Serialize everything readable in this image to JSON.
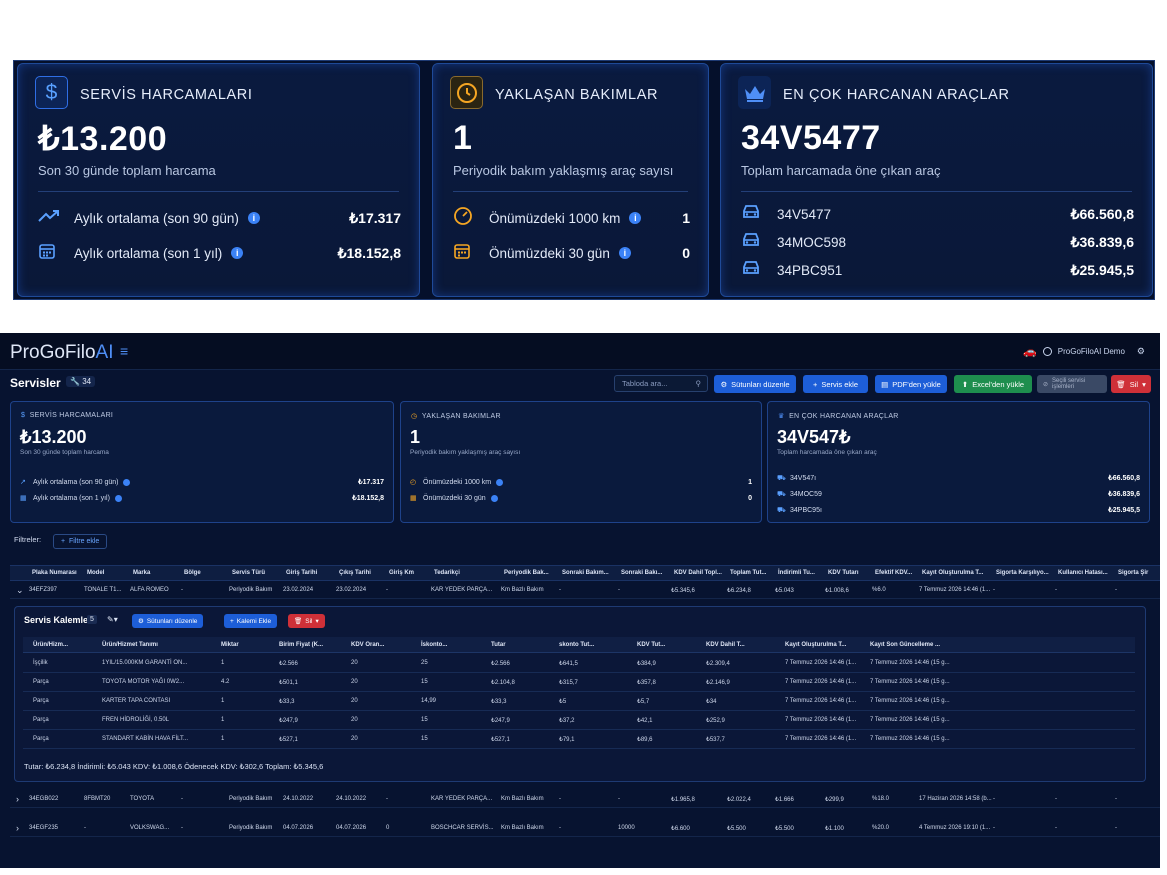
{
  "zoom": {
    "service": {
      "icon": "dollar-icon",
      "title": "SERVİS HARCAMALARI",
      "big": "₺13.200",
      "sub": "Son 30 günde toplam harcama",
      "rows": [
        {
          "icon": "trend-up-icon",
          "label": "Aylık ortalama (son 90 gün)",
          "value": "₺17.317"
        },
        {
          "icon": "calendar-icon",
          "label": "Aylık ortalama (son 1 yıl)",
          "value": "₺18.152,8"
        }
      ]
    },
    "maintenance": {
      "icon": "clock-icon",
      "title": "YAKLAŞAN BAKIMLAR",
      "big": "1",
      "sub": "Periyodik bakım yaklaşmış araç sayısı",
      "rows": [
        {
          "icon": "gauge-icon",
          "label": "Önümüzdeki 1000 km",
          "value": "1"
        },
        {
          "icon": "calendar-icon",
          "label": "Önümüzdeki 30 gün",
          "value": "0"
        }
      ]
    },
    "top": {
      "icon": "crown-icon",
      "title": "EN ÇOK HARCANAN ARAÇLAR",
      "big": "34V5477",
      "sub": "Toplam harcamada öne çıkan araç",
      "rows": [
        {
          "icon": "car-icon",
          "label": "34V5477",
          "value": "₺66.560,8"
        },
        {
          "icon": "car-icon",
          "label": "34MOC598",
          "value": "₺36.839,6"
        },
        {
          "icon": "car-icon",
          "label": "34PBC951",
          "value": "₺25.945,5"
        }
      ]
    }
  },
  "app": {
    "logo_main": "ProGoFilo",
    "logo_ai": "AI",
    "user": "ProGoFiloAI Demo",
    "page_title": "Servisler",
    "count": "34",
    "search_placeholder": "Tabloda ara...",
    "buttons": {
      "columns": "Sütunları düzenle",
      "add": "Servis ekle",
      "pdf": "PDF'den yükle",
      "excel": "Excel'den yükle",
      "selected": "Seçili servisi işlemleri",
      "delete": "Sil"
    },
    "cards": {
      "service": {
        "title": "SERVİS HARCAMALARI",
        "big": "₺13.200",
        "sub": "Son 30 günde toplam harcama",
        "rows": [
          {
            "label": "Aylık ortalama (son 90 gün)",
            "value": "₺17.317"
          },
          {
            "label": "Aylık ortalama (son 1 yıl)",
            "value": "₺18.152,8"
          }
        ]
      },
      "maintenance": {
        "title": "YAKLAŞAN BAKIMLAR",
        "big": "1",
        "sub": "Periyodik bakım yaklaşmış araç sayısı",
        "rows": [
          {
            "label": "Önümüzdeki 1000 km",
            "value": "1"
          },
          {
            "label": "Önümüzdeki 30 gün",
            "value": "0"
          }
        ]
      },
      "top": {
        "title": "EN ÇOK HARCANAN ARAÇLAR",
        "big": "34V547₺",
        "sub": "Toplam harcamada öne çıkan araç",
        "rows": [
          {
            "label": "34V547ı",
            "value": "₺66.560,8"
          },
          {
            "label": "34MOC59",
            "value": "₺36.839,6"
          },
          {
            "label": "34PBC95ı",
            "value": "₺25.945,5"
          }
        ]
      }
    },
    "filters_label": "Filtreler:",
    "add_filter": "Filtre ekle",
    "columns": [
      "Plaka Numarası",
      "Model",
      "Marka",
      "Bölge",
      "Servis Türü",
      "Giriş Tarihi",
      "Çıkış Tarihi",
      "Giriş Km",
      "Tedarikçi",
      "Periyodik Bak...",
      "Sonraki Bakım...",
      "Sonraki Bakı...",
      "KDV Dahil Topl...",
      "Toplam Tut...",
      "İndirimli Tu...",
      "KDV Tutarı",
      "Efektif KDV...",
      "Kayıt Oluşturulma T...",
      "Sigorta Karşılıyo...",
      "Kullanıcı Hatası...",
      "Sigorta Şir"
    ],
    "rows": [
      [
        "34EFZ397",
        "TONALE T1...",
        "ALFA ROMEO",
        "-",
        "Periyodik Bakım",
        "23.02.2024",
        "23.02.2024",
        "-",
        "KAR YEDEK PARÇA...",
        "Km Bazlı Bakım",
        "-",
        "-",
        "₺5.345,6",
        "₺6.234,8",
        "₺5.043",
        "₺1.008,6",
        "%6.0",
        "7 Temmuz 2026 14:46 (1...",
        "-",
        "-",
        "-"
      ],
      [
        "34EGB022",
        "8FBMT20",
        "TOYOTA",
        "-",
        "Periyodik Bakım",
        "24.10.2022",
        "24.10.2022",
        "-",
        "KAR YEDEK PARÇA...",
        "Km Bazlı Bakım",
        "-",
        "-",
        "₺1.965,8",
        "₺2.022,4",
        "₺1.666",
        "₺299,9",
        "%18.0",
        "17 Haziran 2026 14:58 (b...",
        "-",
        "-",
        "-"
      ],
      [
        "34EGF235",
        "-",
        "VOLKSWAG...",
        "-",
        "Periyodik Bakım",
        "04.07.2026",
        "04.07.2026",
        "0",
        "BOSCHCAR SERVİS...",
        "Km Bazlı Bakım",
        "-",
        "10000",
        "₺6.600",
        "₺5.500",
        "₺5.500",
        "₺1.100",
        "%20.0",
        "4 Temmuz 2026 19:10 (1...",
        "-",
        "-",
        "-"
      ]
    ],
    "sub": {
      "title": "Servis Kalemleri",
      "count": "5",
      "columns_btn": "Sütunları düzenle",
      "add_btn": "Kalemi Ekle",
      "delete_btn": "Sil",
      "columns": [
        "Ürün/Hizm...",
        "Ürün/Hizmet Tanımı",
        "Miktar",
        "Birim Fiyat (K...",
        "KDV Oran...",
        "İskonto...",
        "Tutar",
        "skonto Tut...",
        "KDV Tut...",
        "KDV Dahil T...",
        "Kayıt Oluşturulma T...",
        "Kayıt Son Güncelleme ..."
      ],
      "rows": [
        [
          "İşçilik",
          "1YIL/15.000KM GARANTİ ON...",
          "1",
          "₺2.566",
          "20",
          "25",
          "₺2.566",
          "₺641,5",
          "₺384,9",
          "₺2.309,4",
          "7 Temmuz 2026 14:46 (1...",
          "7 Temmuz 2026 14:46 (15 g..."
        ],
        [
          "Parça",
          "TOYOTA MOTOR YAĞI 0W2...",
          "4.2",
          "₺501,1",
          "20",
          "15",
          "₺2.104,8",
          "₺315,7",
          "₺357,8",
          "₺2.146,9",
          "7 Temmuz 2026 14:46 (1...",
          "7 Temmuz 2026 14:46 (15 g..."
        ],
        [
          "Parça",
          "KARTER TAPA CONTASI",
          "1",
          "₺33,3",
          "20",
          "14,99",
          "₺33,3",
          "₺5",
          "₺5,7",
          "₺34",
          "7 Temmuz 2026 14:46 (1...",
          "7 Temmuz 2026 14:46 (15 g..."
        ],
        [
          "Parça",
          "FREN HİDROLİĞİ, 0.50L",
          "1",
          "₺247,9",
          "20",
          "15",
          "₺247,9",
          "₺37,2",
          "₺42,1",
          "₺252,9",
          "7 Temmuz 2026 14:46 (1...",
          "7 Temmuz 2026 14:46 (15 g..."
        ],
        [
          "Parça",
          "STANDART KABİN HAVA FİLT...",
          "1",
          "₺527,1",
          "20",
          "15",
          "₺527,1",
          "₺79,1",
          "₺89,6",
          "₺537,7",
          "7 Temmuz 2026 14:46 (1...",
          "7 Temmuz 2026 14:46 (15 g..."
        ]
      ],
      "totals": "Tutar: ₺6.234,8   İndirimli: ₺5.043   KDV: ₺1.008,6   Ödenecek KDV: ₺302,6   Toplam: ₺5.345,6"
    }
  },
  "colors": {
    "accent": "#3b82f6",
    "background": "#071330",
    "orange": "#f5a623"
  }
}
